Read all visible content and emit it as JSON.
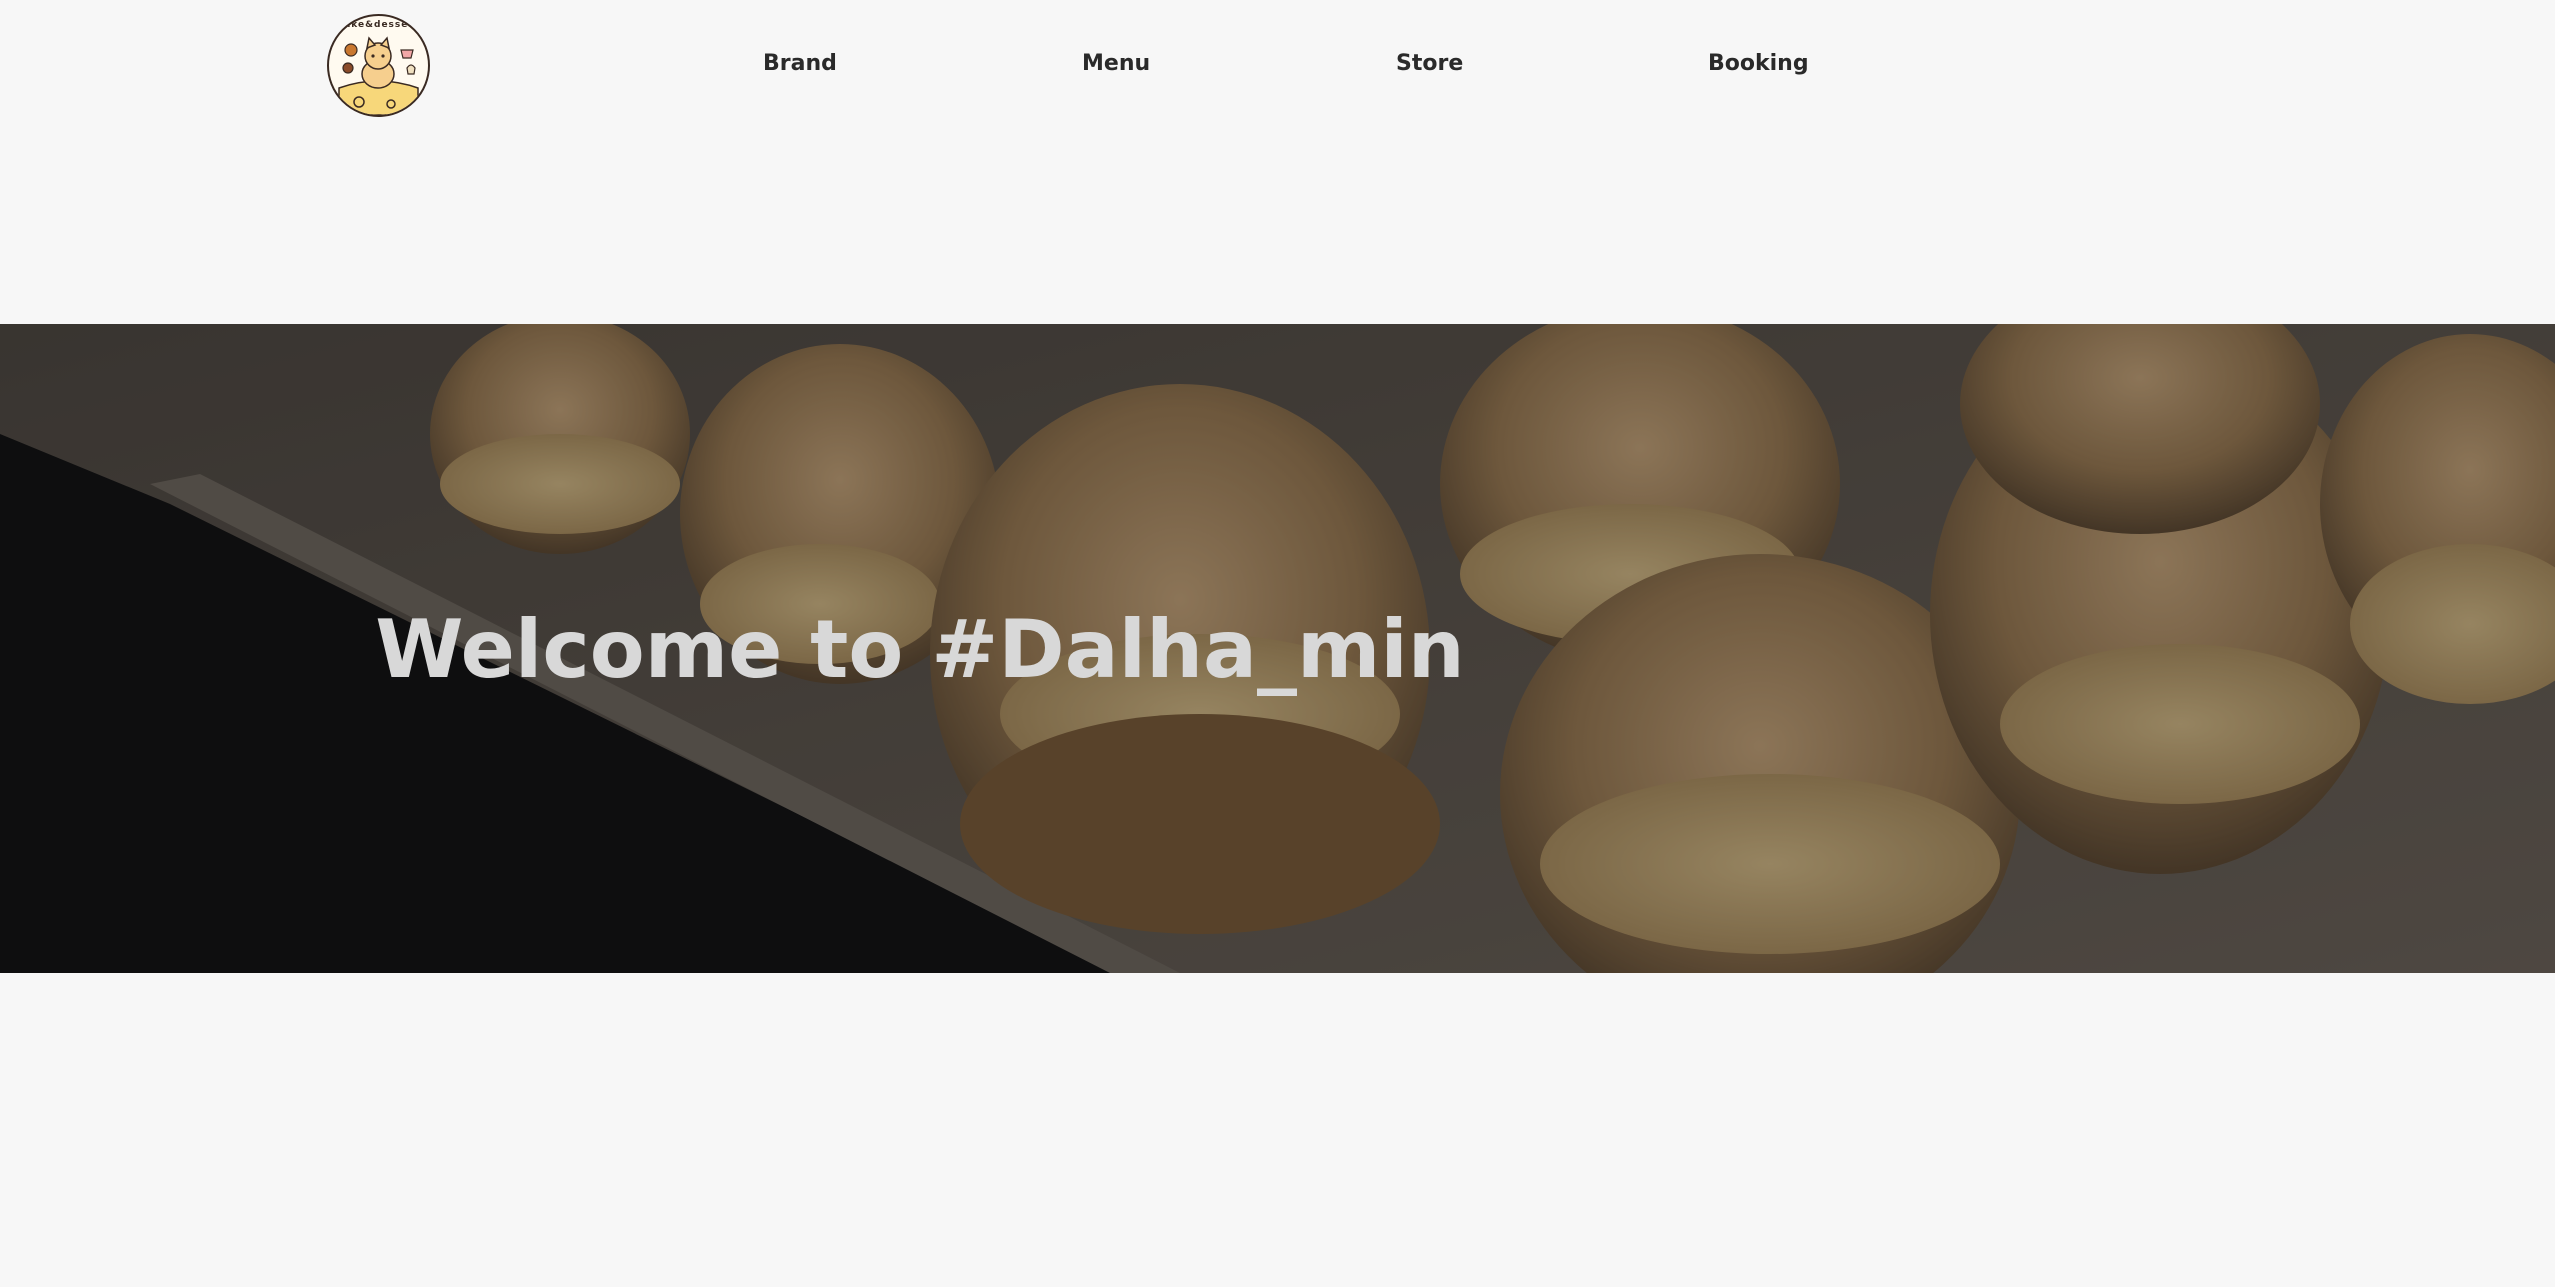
{
  "brand": {
    "logo_text": "cake&dessert",
    "logo_name": "cat-mascot-logo"
  },
  "nav": {
    "items": [
      {
        "label": "Brand"
      },
      {
        "label": "Menu"
      },
      {
        "label": "Store"
      },
      {
        "label": "Booking"
      }
    ]
  },
  "hero": {
    "title": "Welcome to #Dalha_min",
    "image_subject": "cream puffs on tray"
  },
  "colors": {
    "background": "#f7f7f7",
    "nav_text": "#2a2a2a",
    "hero_title": "#d8d8d8",
    "hero_overlay": "#1a1713"
  }
}
